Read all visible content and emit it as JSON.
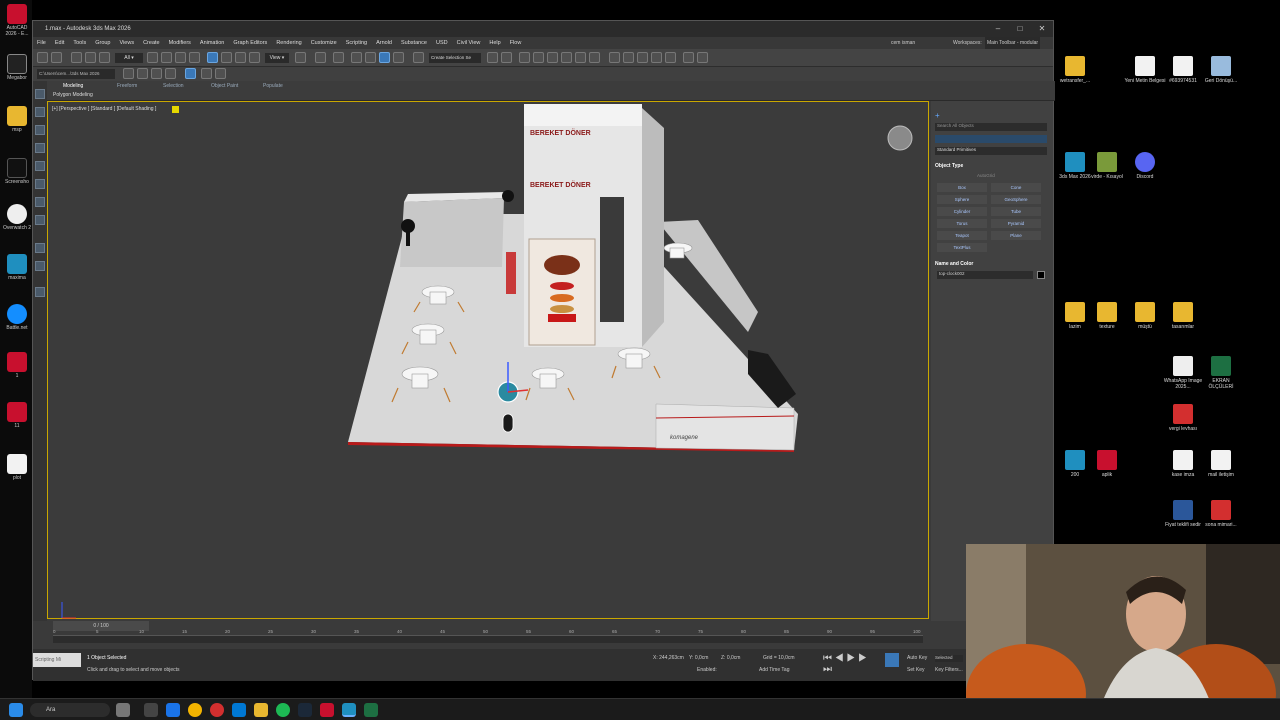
{
  "window": {
    "title": "1.max - Autodesk 3ds Max 2026",
    "menus": [
      "File",
      "Edit",
      "Tools",
      "Group",
      "Views",
      "Create",
      "Modifiers",
      "Animation",
      "Graph Editors",
      "Rendering",
      "Customize",
      "Scripting",
      "Arnold",
      "Substance",
      "USD",
      "Civil View",
      "Help",
      "Flow"
    ],
    "user": "cem isman",
    "workspaces_label": "Workspaces:",
    "workspace_value": "Main Toolbar - modular",
    "path": "C:\\Users\\cem...\\3ds Max 2026",
    "selection_set": "Create Selection Se"
  },
  "ribbon": {
    "tabs": [
      "Modeling",
      "Freeform",
      "Selection",
      "Object Paint",
      "Populate"
    ],
    "sub": "Polygon Modeling"
  },
  "viewport": {
    "label": "[+] [Perspective ] [Standard ] [Default Shading ]",
    "signs": [
      "BEREKET DÖNER",
      "BEREKET DÖNER",
      "komagene"
    ]
  },
  "command_panel": {
    "dropdown": "Standard Primitives",
    "search": "Search All Objects",
    "object_type_title": "Object Type",
    "autogrid": "AutoGrid",
    "buttons": [
      "Box",
      "Cone",
      "Sphere",
      "GeoSphere",
      "Cylinder",
      "Tube",
      "Torus",
      "Pyramid",
      "Teapot",
      "Plane",
      "TextPlus",
      ""
    ],
    "name_color_title": "Name and Color",
    "object_name": "top-clock002"
  },
  "timeline": {
    "slider_label": "0 / 100",
    "ticks": [
      "0",
      "5",
      "10",
      "15",
      "20",
      "25",
      "30",
      "35",
      "40",
      "45",
      "50",
      "55",
      "60",
      "65",
      "70",
      "75",
      "80",
      "85",
      "90",
      "95",
      "100"
    ]
  },
  "status": {
    "selected": "1 Object Selected",
    "prompt": "Click and drag to select and move objects",
    "scripting": "Scripting Mi",
    "x": "X: 244,263cm",
    "y": "Y: 0,0cm",
    "z": "Z: 0,0cm",
    "grid": "Grid = 10,0cm",
    "enabled": "Enabled:",
    "add_time_tag": "Add Time Tag",
    "auto_key": "Auto Key",
    "selected_mode": "Selected",
    "set_key": "Set Key",
    "key_filters": "Key Filters..."
  },
  "left_desktop": [
    "AutoCAD 2026 - E...",
    "Megabor",
    "msp",
    "Screensho",
    "Overwatch 2",
    "maxima",
    "Battle.net",
    "1",
    "11",
    "plot"
  ],
  "right_desktop": [
    {
      "label": "wetransfer_...",
      "type": "folder"
    },
    {
      "label": "Yeni Metin Belgesi",
      "type": "doc"
    },
    {
      "label": "#693974531",
      "type": "doc"
    },
    {
      "label": "Geri Dönüşü...",
      "type": "recycle"
    },
    {
      "label": "3ds Max 2026",
      "type": "max"
    },
    {
      "label": "virde - Kısayol",
      "type": "app"
    },
    {
      "label": "Discord",
      "type": "discord"
    },
    {
      "label": "lazim",
      "type": "folder"
    },
    {
      "label": "texture",
      "type": "folder"
    },
    {
      "label": "müştü",
      "type": "folder"
    },
    {
      "label": "tasarımlar",
      "type": "folder"
    },
    {
      "label": "WhatsApp Image 2025...",
      "type": "img"
    },
    {
      "label": "EKRAN ÖLÇÜLERİ",
      "type": "excel"
    },
    {
      "label": "vergi levhası",
      "type": "pdf"
    },
    {
      "label": "200",
      "type": "max"
    },
    {
      "label": "aplik",
      "type": "autocad"
    },
    {
      "label": "kase imza",
      "type": "doc"
    },
    {
      "label": "mail iletişim",
      "type": "doc"
    },
    {
      "label": "Fiyat teklifi sedir",
      "type": "word"
    },
    {
      "label": "sona mimari...",
      "type": "pdf"
    }
  ],
  "taskbar": {
    "search": "Ara"
  },
  "colors": {
    "accent": "#3a78b8",
    "selection_yellow": "#c9a700",
    "bg_ui": "#3a3a3a",
    "red_trim": "#b81a1a"
  }
}
